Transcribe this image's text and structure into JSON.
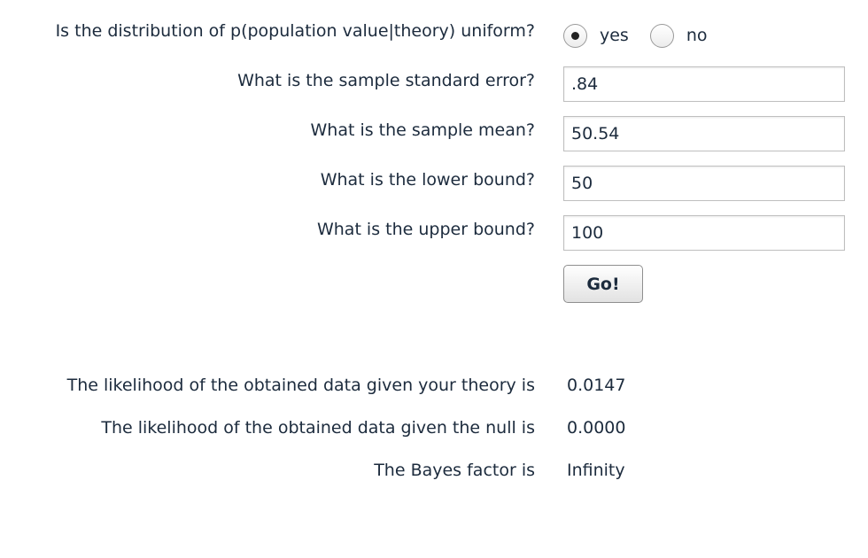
{
  "form": {
    "uniform_question": "Is the distribution of p(population value|theory) uniform?",
    "uniform_options": {
      "yes_label": "yes",
      "no_label": "no",
      "selected": "yes"
    },
    "se_label": "What is the sample standard error?",
    "se_value": ".84",
    "mean_label": "What is the sample mean?",
    "mean_value": "50.54",
    "lower_label": "What is the lower bound?",
    "lower_value": "50",
    "upper_label": "What is the upper bound?",
    "upper_value": "100",
    "go_label": "Go!"
  },
  "results": {
    "theory_label": "The likelihood of the obtained data given your theory is",
    "theory_value": "0.0147",
    "null_label": "The likelihood of the obtained data given the null is",
    "null_value": "0.0000",
    "bayes_label": "The Bayes factor is",
    "bayes_value": "Infinity"
  }
}
